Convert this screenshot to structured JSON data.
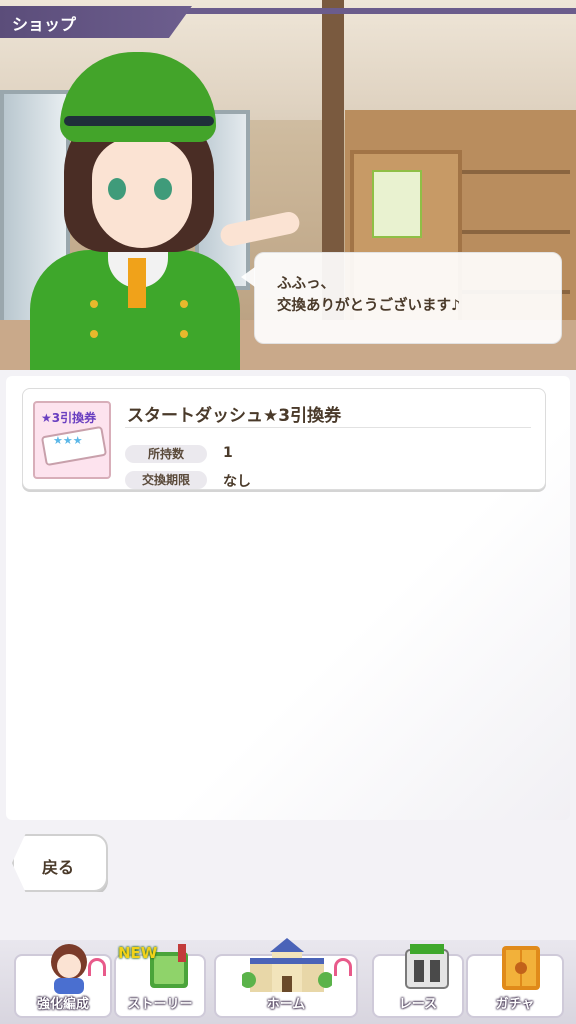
{
  "header": {
    "title": "ショップ"
  },
  "dialogue": {
    "line1": "ふふっ、",
    "line2": "交換ありがとうございます♪"
  },
  "item": {
    "name": "スタートダッシュ★3引換券",
    "ticket_label": "★3引換券",
    "rows": [
      {
        "label": "所持数",
        "value": "1"
      },
      {
        "label": "交換期限",
        "value": "なし"
      }
    ]
  },
  "back_button": {
    "label": "戻る"
  },
  "nav": {
    "items": [
      {
        "label": "強化編成",
        "icon": "character-icon",
        "badge": true
      },
      {
        "label": "ストーリー",
        "icon": "book-icon",
        "new": "NEW"
      },
      {
        "label": "ホーム",
        "icon": "school-building-icon",
        "badge": true
      },
      {
        "label": "レース",
        "icon": "race-gate-icon"
      },
      {
        "label": "ガチャ",
        "icon": "gacha-door-icon"
      }
    ]
  }
}
